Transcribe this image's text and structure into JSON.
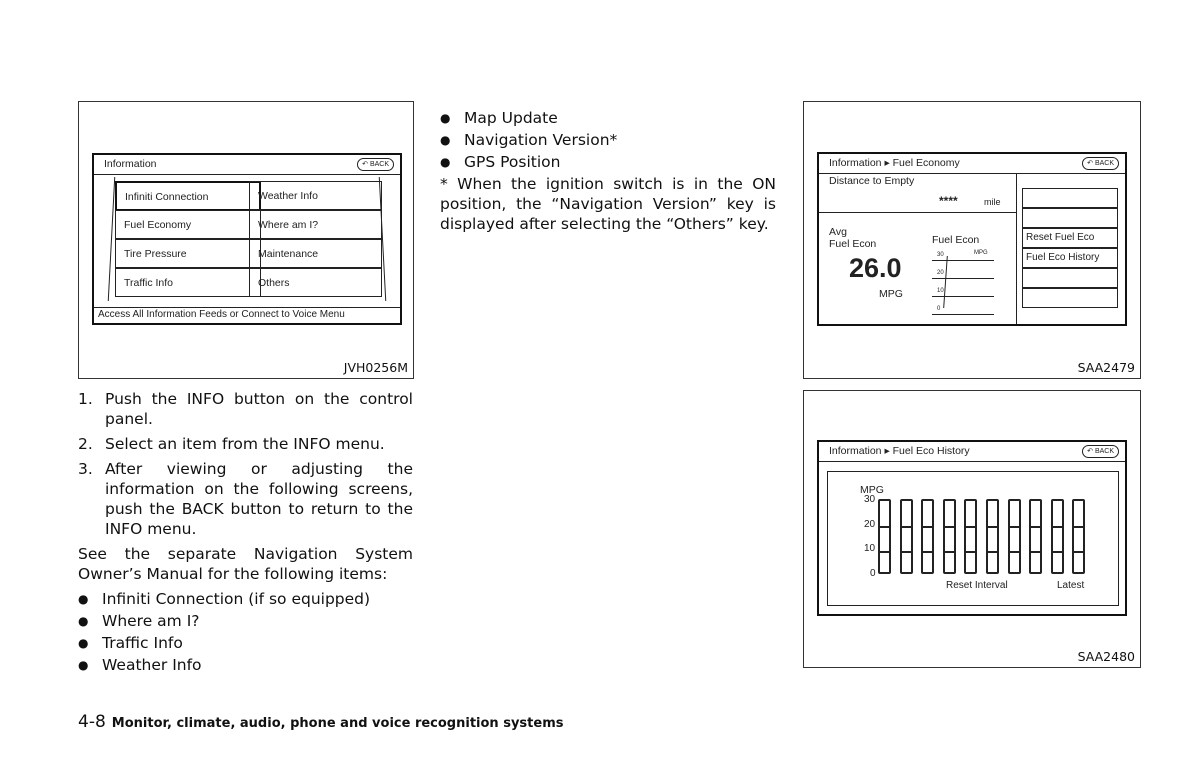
{
  "left_column": {
    "steps": [
      {
        "n": "1.",
        "text": "Push the INFO button on the control panel."
      },
      {
        "n": "2.",
        "text": "Select an item from the INFO menu."
      },
      {
        "n": "3.",
        "text": "After viewing or adjusting the information on the following screens, push the BACK button to return to the INFO menu."
      }
    ],
    "see_text": "See the separate Navigation System Owner’s Manual for the following items:",
    "bullets": [
      "Infiniti Connection (if so equipped)",
      "Where am I?",
      "Traffic Info",
      "Weather Info"
    ]
  },
  "middle_column": {
    "bullets": [
      "Map Update",
      "Navigation Version*",
      "GPS Position"
    ],
    "note": "* When the ignition switch is in the ON position, the “Navigation Version” key is displayed after selecting the “Others” key."
  },
  "figure_info": {
    "code": "JVH0256M",
    "title": "Information",
    "back": "BACK",
    "left_items": [
      "Infiniti Connection",
      "Fuel Economy",
      "Tire Pressure",
      "Traffic Info"
    ],
    "right_items": [
      "Weather Info",
      "Where am I?",
      "Maintenance",
      "Others"
    ],
    "status": "Access All Information Feeds or Connect to Voice Menu"
  },
  "figure_fuel": {
    "code": "SAA2479",
    "title": "Information ▸ Fuel Economy",
    "back": "BACK",
    "distance_label": "Distance to Empty",
    "distance_value": "****",
    "distance_unit": "mile",
    "avg_label1": "Avg",
    "avg_label2": "Fuel Econ",
    "avg_value": "26.0",
    "avg_unit": "MPG",
    "graph_title": "Fuel Econ",
    "graph_unit": "MPG",
    "graph_ticks": [
      "30",
      "20",
      "10",
      "0"
    ],
    "menu": [
      "",
      "",
      "Reset Fuel Eco",
      "Fuel Eco History",
      "",
      ""
    ]
  },
  "figure_history": {
    "code": "SAA2480",
    "title": "Information ▸ Fuel Eco History",
    "back": "BACK",
    "ylabel": "MPG",
    "ticks": [
      "30",
      "20",
      "10",
      "0"
    ],
    "bar_count": 10,
    "label_reset": "Reset Interval",
    "label_latest": "Latest"
  },
  "page_footer": {
    "page": "4-8",
    "section": "Monitor, climate, audio, phone and voice recognition systems"
  }
}
